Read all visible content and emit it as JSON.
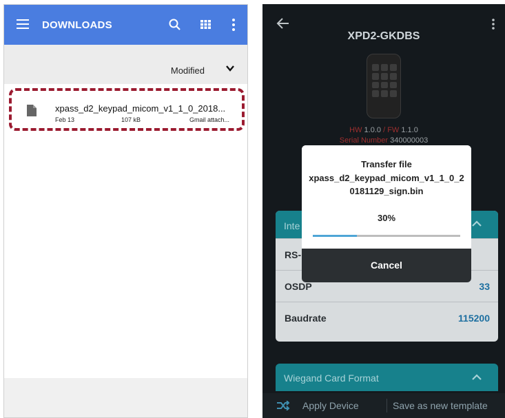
{
  "left": {
    "app_title": "DOWNLOADS",
    "sort": {
      "label": "Modified"
    },
    "file": {
      "name": "xpass_d2_keypad_micom_v1_1_0_2018...",
      "date": "Feb 13",
      "size": "107 kB",
      "source": "Gmail attach..."
    },
    "icons": [
      "menu-icon",
      "search-icon",
      "grid-view-icon",
      "more-vert-icon",
      "chevron-down-icon",
      "file-icon"
    ]
  },
  "right": {
    "device_title": "XPD2-GKDBS",
    "hw_label": "HW",
    "hw_value": "1.0.0",
    "fw_sep": " / ",
    "fw_label": "FW",
    "fw_value": "1.1.0",
    "serial_label": "Serial Number",
    "serial_value": "340000003",
    "interface_section": {
      "label": "Inte",
      "rows": [
        {
          "key": "RS-",
          "value": ""
        },
        {
          "key": "OSDP",
          "value": "33"
        },
        {
          "key": "Baudrate",
          "value": "115200"
        }
      ]
    },
    "wiegand_section": {
      "label": "Wiegand Card Format"
    },
    "bottom": {
      "apply": "Apply Device",
      "save": "Save as new template"
    },
    "dialog": {
      "title": "Transfer file",
      "filename": "xpass_d2_keypad_micom_v1_1_0_20181129_sign.bin",
      "percent": "30%",
      "progress": 0.3,
      "cancel": "Cancel"
    },
    "accent": "#17818c"
  }
}
